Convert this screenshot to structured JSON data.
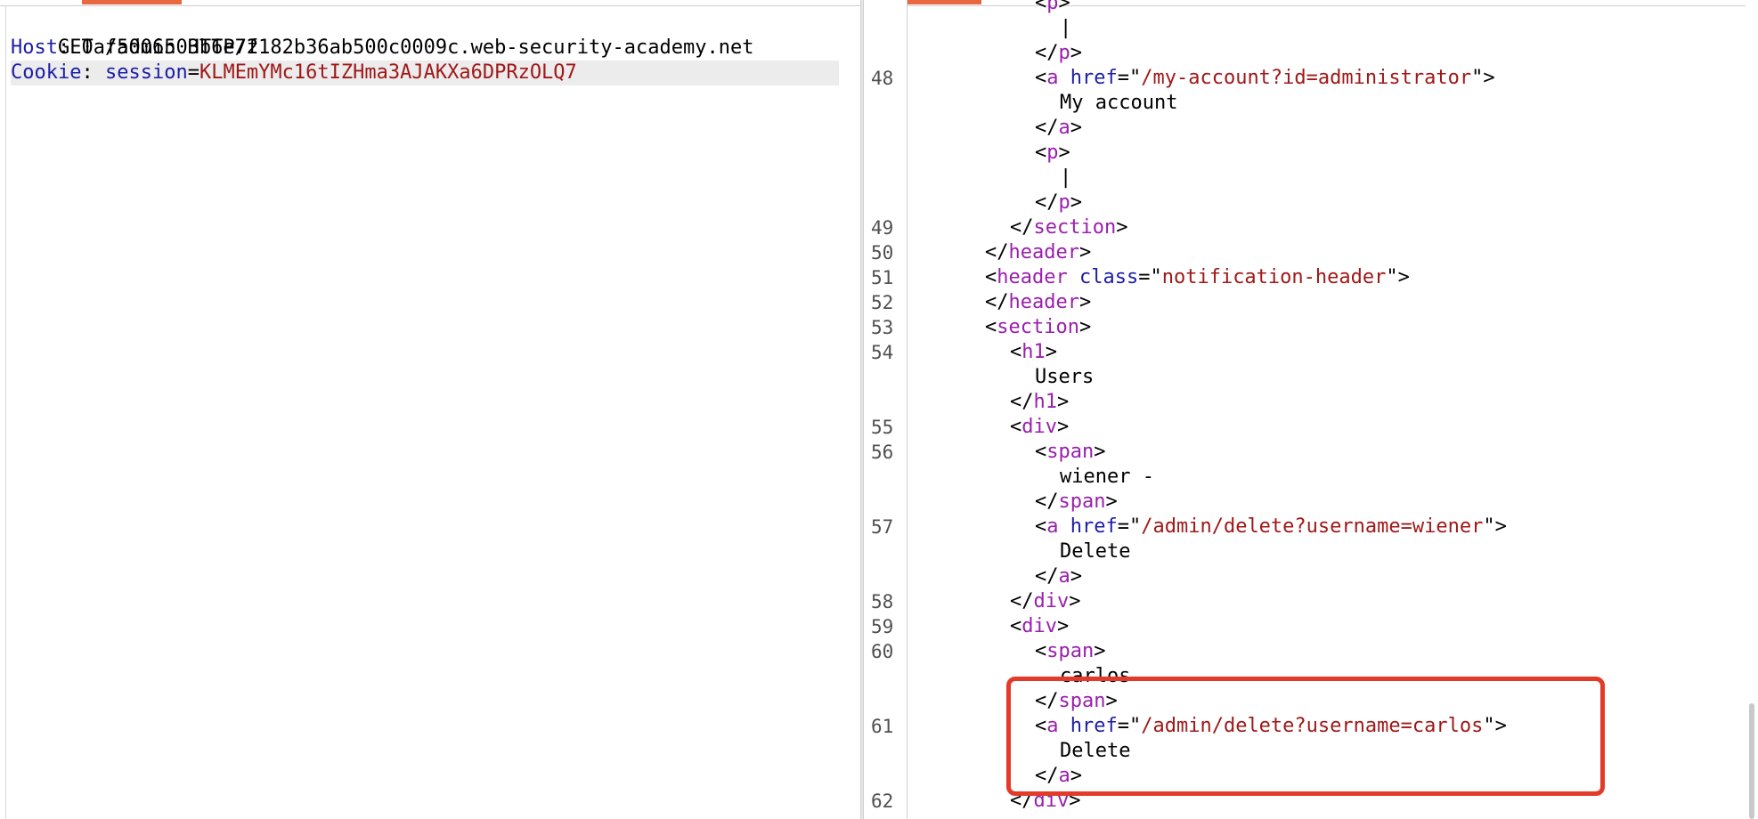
{
  "request": {
    "line1": "GET /admin HTTP/2",
    "host_key": "Host",
    "host_value": "0af5006503b6e7f182b36ab500c0009c.web-security-academy.net",
    "cookie_key": "Cookie",
    "cookie_name": "session",
    "cookie_value": "KLMEmYMc16tIZHma3AJAKXa6DPRzOLQ7"
  },
  "response": {
    "line_numbers": {
      "n48": "48",
      "n49": "49",
      "n50": "50",
      "n51": "51",
      "n52": "52",
      "n53": "53",
      "n54": "54",
      "n55": "55",
      "n56": "56",
      "n57": "57",
      "n58": "58",
      "n59": "59",
      "n60": "60",
      "n61": "61",
      "n62": "62"
    },
    "text": {
      "pipe": "|",
      "my_account": "My account",
      "users": "Users",
      "wiener": "wiener -",
      "delete": "Delete",
      "carlos": "carlos"
    },
    "tags": {
      "p": "p",
      "a": "a",
      "section": "section",
      "header": "header",
      "h1": "h1",
      "div": "div",
      "span": "span"
    },
    "attrs": {
      "href": "href",
      "class": "class"
    },
    "values": {
      "my_account_href": "/my-account?id=administrator",
      "notification_class": "notification-header",
      "delete_wiener_href": "/admin/delete?username=wiener",
      "delete_carlos_href": "/admin/delete?username=carlos"
    }
  },
  "colors": {
    "tab_indicator": "#e8683f",
    "highlight_box": "#e33a2a"
  }
}
